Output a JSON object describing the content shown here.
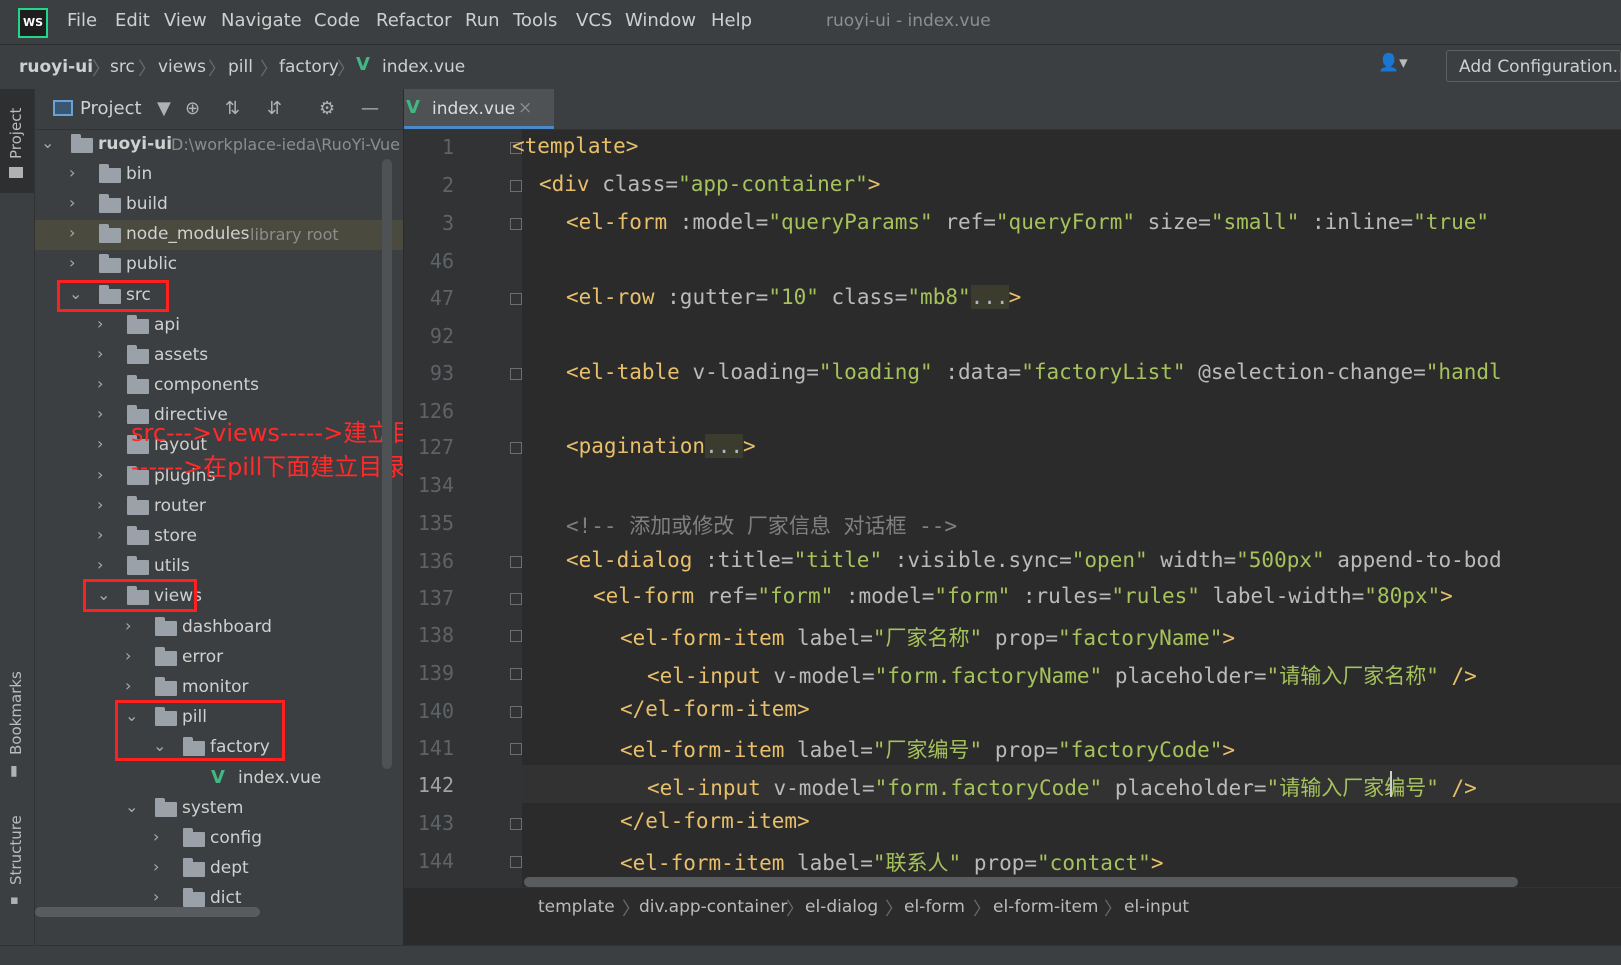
{
  "menubar": {
    "logo": "WS",
    "items": [
      "File",
      "Edit",
      "View",
      "Navigate",
      "Code",
      "Refactor",
      "Run",
      "Tools",
      "VCS",
      "Window",
      "Help"
    ],
    "window_title": "ruoyi-ui - index.vue"
  },
  "navbar": {
    "breadcrumbs": [
      "ruoyi-ui",
      "src",
      "views",
      "pill",
      "factory",
      "index.vue"
    ],
    "add_configuration": "Add Configuration..."
  },
  "toolstrip": {
    "project": "Project",
    "bookmarks": "Bookmarks",
    "structure": "Structure"
  },
  "project_panel": {
    "title": "Project",
    "tree": [
      {
        "label": "ruoyi-ui",
        "hint": "D:\\workplace-ieda\\RuoYi-Vue",
        "bold": true
      },
      {
        "label": "bin"
      },
      {
        "label": "build"
      },
      {
        "label": "node_modules",
        "hint": "library root"
      },
      {
        "label": "public"
      },
      {
        "label": "src"
      },
      {
        "label": "api"
      },
      {
        "label": "assets"
      },
      {
        "label": "components"
      },
      {
        "label": "directive"
      },
      {
        "label": "layout"
      },
      {
        "label": "plugins"
      },
      {
        "label": "router"
      },
      {
        "label": "store"
      },
      {
        "label": "utils"
      },
      {
        "label": "views"
      },
      {
        "label": "dashboard"
      },
      {
        "label": "error"
      },
      {
        "label": "monitor"
      },
      {
        "label": "pill"
      },
      {
        "label": "factory"
      },
      {
        "label": "index.vue"
      },
      {
        "label": "system"
      },
      {
        "label": "config"
      },
      {
        "label": "dept"
      },
      {
        "label": "dict"
      }
    ],
    "annotations": [
      "src--->views----->建立目录pill",
      "------>在pill下面建立目录factory"
    ]
  },
  "editor": {
    "tab_label": "index.vue",
    "line_numbers": [
      "1",
      "2",
      "3",
      "46",
      "47",
      "92",
      "93",
      "126",
      "127",
      "134",
      "135",
      "136",
      "137",
      "138",
      "139",
      "140",
      "141",
      "142",
      "143",
      "144"
    ],
    "current_line": "142",
    "code": {
      "l1_tag": "<template>",
      "l2_tag": "<div ",
      "l2_attr": "class=",
      "l2_val": "\"app-container\"",
      "l2_end": ">",
      "l3_tag": "<el-form ",
      "l3_a1": ":model=",
      "l3_v1": "\"queryParams\"",
      "l3_a2": " ref=",
      "l3_v2": "\"queryForm\"",
      "l3_a3": " size=",
      "l3_v3": "\"small\"",
      "l3_a4": " :inline=",
      "l3_v4": "\"true\"",
      "l47_tag": "<el-row ",
      "l47_a1": ":gutter=",
      "l47_v1": "\"10\"",
      "l47_a2": " class=",
      "l47_v2": "\"mb8\"",
      "l47_dots": "...",
      "l47_end": ">",
      "l93_tag": "<el-table ",
      "l93_a1": "v-loading=",
      "l93_v1": "\"loading\"",
      "l93_a2": " :data=",
      "l93_v2": "\"factoryList\"",
      "l93_a3": " @selection-change=",
      "l93_v3": "\"handl",
      "l127_tag": "<pagination",
      "l127_dots": "...",
      "l127_end": ">",
      "l135_cmt": "<!-- 添加或修改 厂家信息 对话框 -->",
      "l136_tag": "<el-dialog ",
      "l136_a1": ":title=",
      "l136_v1": "\"title\"",
      "l136_a2": " :visible.sync=",
      "l136_v2": "\"open\"",
      "l136_a3": " width=",
      "l136_v3": "\"500px\"",
      "l136_a4": " append-to-bod",
      "l137_tag": "<el-form ",
      "l137_a1": "ref=",
      "l137_v1": "\"form\"",
      "l137_a2": " :model=",
      "l137_v2": "\"form\"",
      "l137_a3": " :rules=",
      "l137_v3": "\"rules\"",
      "l137_a4": " label-width=",
      "l137_v4": "\"80px\"",
      "l137_end": ">",
      "l138_tag": "<el-form-item ",
      "l138_a1": "label=",
      "l138_v1": "\"厂家名称\"",
      "l138_a2": " prop=",
      "l138_v2": "\"factoryName\"",
      "l138_end": ">",
      "l139_tag": "<el-input ",
      "l139_a1": "v-model=",
      "l139_v1": "\"form.factoryName\"",
      "l139_a2": " placeholder=",
      "l139_v2": "\"请输入厂家名称\"",
      "l139_end": " />",
      "l140_tag": "</el-form-item>",
      "l141_tag": "<el-form-item ",
      "l141_a1": "label=",
      "l141_v1": "\"厂家编号\"",
      "l141_a2": " prop=",
      "l141_v2": "\"factoryCode\"",
      "l141_end": ">",
      "l142_tag": "<el-input ",
      "l142_a1": "v-model=",
      "l142_v1": "\"form.factoryCode\"",
      "l142_a2": " placeholder=",
      "l142_v2": "\"请输入厂家编号\"",
      "l142_end": " />",
      "l143_tag": "</el-form-item>",
      "l144_tag": "<el-form-item ",
      "l144_a1": "label=",
      "l144_v1": "\"联系人\"",
      "l144_a2": " prop=",
      "l144_v2": "\"contact\"",
      "l144_end": ">"
    },
    "breadcrumb": [
      "template",
      "div.app-container",
      "el-dialog",
      "el-form",
      "el-form-item",
      "el-input"
    ]
  },
  "colors": {
    "tag": "#e8bf6a",
    "attribute": "#bababa",
    "string": "#a5c25c",
    "comment": "#808080",
    "annotation_red": "#ff2020",
    "vue_green": "#41b883"
  }
}
